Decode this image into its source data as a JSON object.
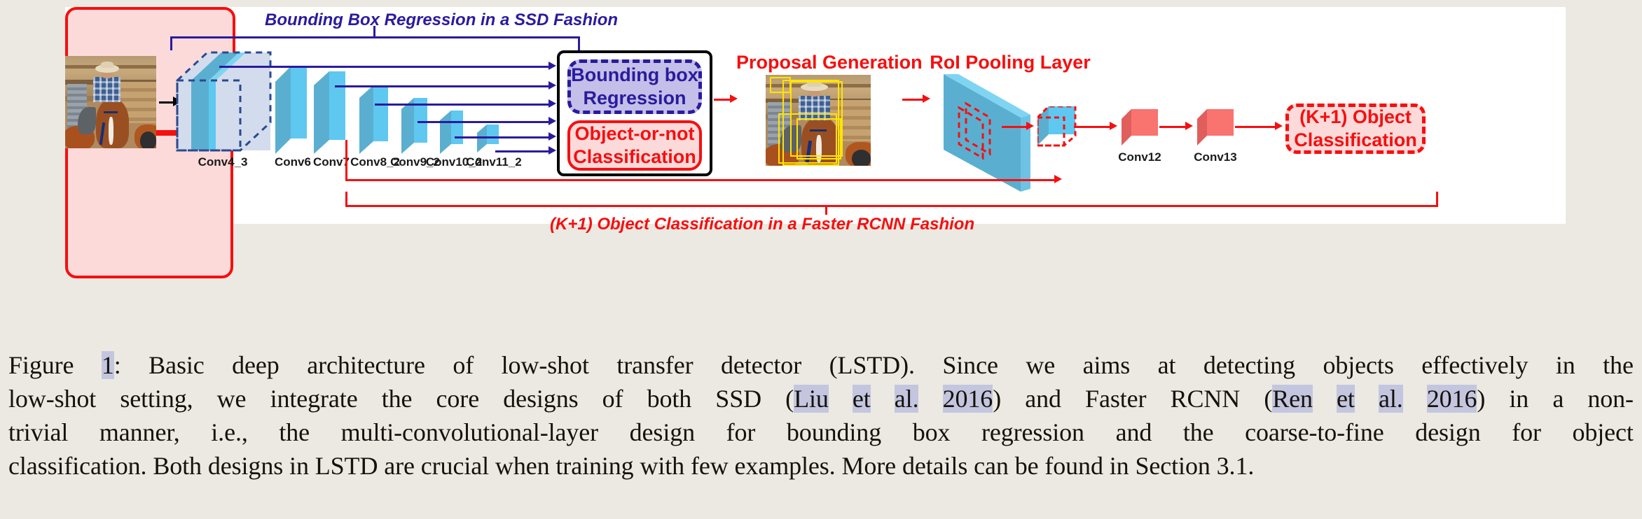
{
  "figure": {
    "top_caption": "Bounding Box Regression in a SSD Fashion",
    "bottom_caption": "(K+1) Object Classification in a Faster RCNN Fashion",
    "backbone_labels": [
      "Conv4_3",
      "Conv6",
      "Conv7",
      "Conv8_2",
      "Conv9_2",
      "Conv10_2",
      "Conv11_2"
    ],
    "head": {
      "bounding_box_regression": "Bounding box\nRegression",
      "bbox_line1": "Bounding box",
      "bbox_line2": "Regression",
      "object_or_not_line1": "Object-or-not",
      "object_or_not_line2": "Classification"
    },
    "proposal_panel_title": "Proposal Generation",
    "roi_panel_title": "RoI Pooling Layer",
    "tail_labels": [
      "Conv12",
      "Conv13"
    ],
    "final_box_line1": "(K+1) Object",
    "final_box_line2": "Classification",
    "colors": {
      "blue_accent": "#2a1b9e",
      "red_accent": "#f60f0f",
      "conv_blue": "#5ec8f0",
      "conv_blue_top": "#7fd4f2",
      "conv_blue_side": "#59b6d6",
      "pale_block": "#d3dced",
      "red_cube": "#f9736f",
      "pink_panel": "#fddada",
      "yellow_proposal": "#ffe400",
      "page_background": "#ece9e2",
      "figure_background": "#ffffff"
    }
  },
  "caption": {
    "label": "Figure",
    "number": "1",
    "lines": [
      {
        "justify": true,
        "parts": [
          {
            "text": "Figure ",
            "hl": false
          },
          {
            "text": "1",
            "hl": true
          },
          {
            "text": ": Basic deep architecture of low-shot transfer detector (LSTD). Since we aims at detecting objects effectively in the",
            "hl": false
          }
        ]
      },
      {
        "justify": true,
        "parts": [
          {
            "text": "low-shot setting, we integrate the core designs of both SSD (",
            "hl": false
          },
          {
            "text": "Liu et al. 2016",
            "hl": true
          },
          {
            "text": ") and Faster RCNN (",
            "hl": false
          },
          {
            "text": "Ren et al. 2016",
            "hl": true
          },
          {
            "text": ") in a non-",
            "hl": false
          }
        ]
      },
      {
        "justify": true,
        "parts": [
          {
            "text": "trivial manner, i.e., the multi-convolutional-layer design for bounding box regression and the coarse-to-fine design for object",
            "hl": false
          }
        ]
      },
      {
        "justify": false,
        "parts": [
          {
            "text": "classification. Both designs in LSTD are crucial when training with few examples. More details can be found in Section 3.1.",
            "hl": false
          }
        ]
      }
    ]
  }
}
